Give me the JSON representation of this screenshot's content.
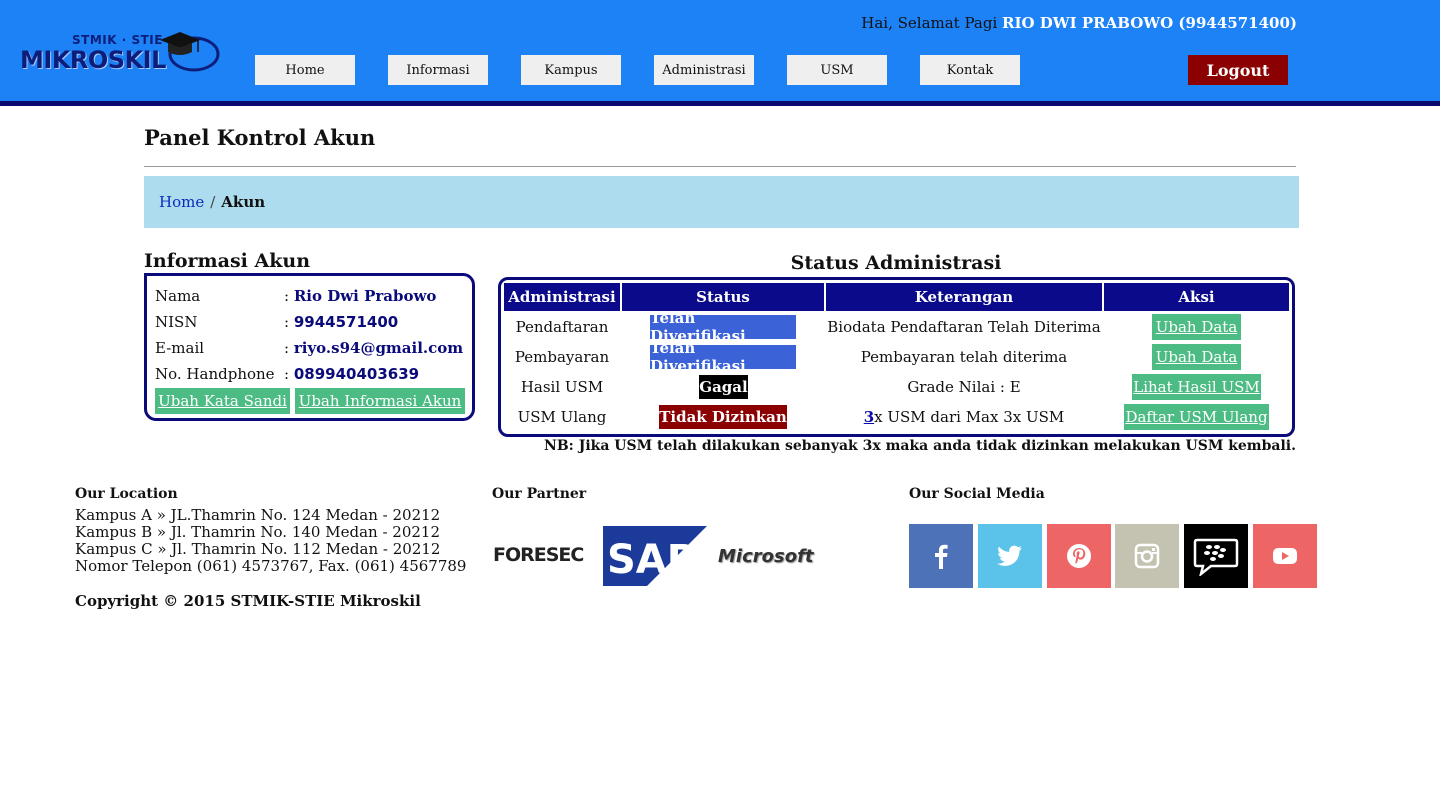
{
  "header": {
    "logo": {
      "top_text": "STMIK · STIE",
      "main_text": "MIKROSKIL"
    },
    "greeting_prefix": "Hai, Selamat Pagi",
    "user_display": "RIO DWI PRABOWO (9944571400)",
    "nav": [
      "Home",
      "Informasi",
      "Kampus",
      "Administrasi",
      "USM",
      "Kontak"
    ],
    "logout_label": "Logout",
    "colors": {
      "bar": "#1e82f7",
      "underline": "#0a0a6e",
      "logout": "#8b0000"
    }
  },
  "page": {
    "title": "Panel Kontrol Akun",
    "breadcrumb": {
      "home": "Home",
      "separator": "/",
      "current": "Akun"
    }
  },
  "account_info": {
    "heading": "Informasi Akun",
    "rows": [
      {
        "label": "Nama",
        "value": "Rio Dwi Prabowo"
      },
      {
        "label": "NISN",
        "value": "9944571400"
      },
      {
        "label": "E-mail",
        "value": "riyo.s94@gmail.com"
      },
      {
        "label": "No. Handphone",
        "value": "089940403639"
      }
    ],
    "separator": ":",
    "buttons": [
      "Ubah Kata Sandi",
      "Ubah Informasi Akun"
    ]
  },
  "status_admin": {
    "heading": "Status Administrasi",
    "columns": [
      "Administrasi",
      "Status",
      "Keterangan",
      "Aksi"
    ],
    "rows": [
      {
        "item": "Pendaftaran",
        "status": "Telah Diverifikasi",
        "status_color": "#3c62d8",
        "note": "Biodata Pendaftaran Telah Diterima",
        "action": "Ubah Data"
      },
      {
        "item": "Pembayaran",
        "status": "Telah Diverifikasi",
        "status_color": "#3c62d8",
        "note": "Pembayaran telah diterima",
        "action": "Ubah Data"
      },
      {
        "item": "Hasil USM",
        "status": "Gagal",
        "status_color": "#000000",
        "note": "Grade Nilai : E",
        "action": "Lihat Hasil USM"
      },
      {
        "item": "USM Ulang",
        "status": "Tidak Dizinkan",
        "status_color": "#8b0000",
        "note_count": "3",
        "note_rest": "x USM dari Max 3x USM",
        "action": "Daftar USM Ulang"
      }
    ],
    "nb": "NB: Jika USM telah dilakukan sebanyak 3x maka anda tidak dizinkan melakukan USM kembali."
  },
  "footer": {
    "location": {
      "heading": "Our Location",
      "lines": [
        "Kampus A » JL.Thamrin No. 124 Medan - 20212",
        "Kampus B » Jl. Thamrin No. 140 Medan - 20212",
        "Kampus C » Jl. Thamrin No. 112 Medan - 20212",
        "Nomor Telepon (061) 4573767, Fax. (061) 4567789"
      ]
    },
    "partner": {
      "heading": "Our Partner",
      "logos": [
        "FORESEC",
        "SAP",
        "Microsoft"
      ]
    },
    "social": {
      "heading": "Our Social Media",
      "items": [
        {
          "icon": "facebook-icon",
          "color": "#4d72b8"
        },
        {
          "icon": "twitter-icon",
          "color": "#5bc3ea"
        },
        {
          "icon": "pinterest-icon",
          "color": "#ee6565"
        },
        {
          "icon": "instagram-icon",
          "color": "#c4c2b0"
        },
        {
          "icon": "bbm-icon",
          "color": "#000000"
        },
        {
          "icon": "youtube-icon",
          "color": "#ee6565"
        }
      ]
    },
    "copyright": "Copyright © 2015 STMIK-STIE Mikroskil"
  }
}
